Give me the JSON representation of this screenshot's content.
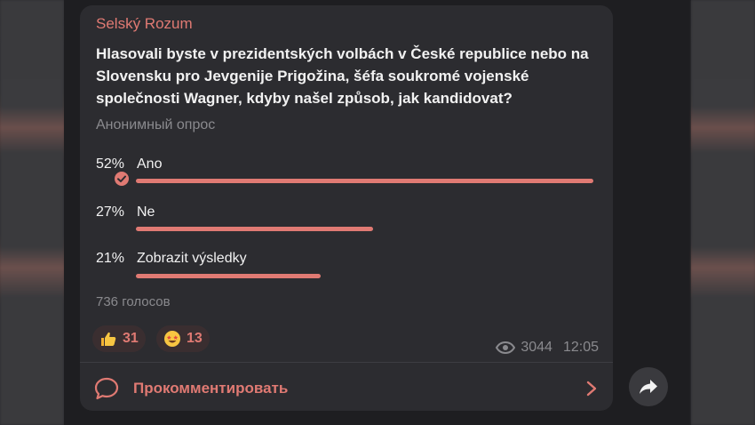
{
  "post": {
    "channel_name": "Selský Rozum",
    "question": "Hlasovali byste v prezidentských volbách v České republice nebo na Slovensku pro Jevgenije Prigožina, šéfa soukromé vojenské společnosti Wagner, kdyby našel způsob, jak kandidovat?",
    "poll_type": "Анонимный опрос",
    "options": [
      {
        "percent_label": "52%",
        "label": "Ano",
        "fraction": 0.52,
        "selected": true
      },
      {
        "percent_label": "27%",
        "label": "Ne",
        "fraction": 0.27,
        "selected": false
      },
      {
        "percent_label": "21%",
        "label": "Zobrazit výsledky",
        "fraction": 0.21,
        "selected": false
      }
    ],
    "votes_label": "736 голосов",
    "reactions": [
      {
        "icon": "thumbs-up-icon",
        "count": "31"
      },
      {
        "icon": "star-struck-emoji-icon",
        "count": "13"
      }
    ],
    "views": "3044",
    "time": "12:05",
    "comment_label": "Прокомментировать"
  },
  "colors": {
    "accent": "#e07a73",
    "bubble": "#2c2c30",
    "text": "#f2f2f2",
    "muted": "#8a8a8e"
  }
}
